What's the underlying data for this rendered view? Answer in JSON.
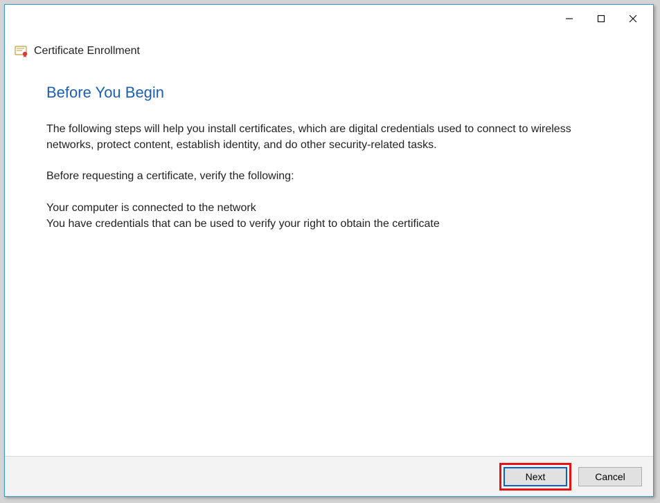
{
  "window_title": "Certificate Enrollment",
  "heading": "Before You Begin",
  "paragraph1": "The following steps will help you install certificates, which are digital credentials used to connect to wireless networks, protect content, establish identity, and do other security-related tasks.",
  "paragraph2": "Before requesting a certificate, verify the following:",
  "line1": "Your computer is connected to the network",
  "line2": "You have credentials that can be used to verify your right to obtain the certificate",
  "buttons": {
    "next": "Next",
    "cancel": "Cancel"
  }
}
